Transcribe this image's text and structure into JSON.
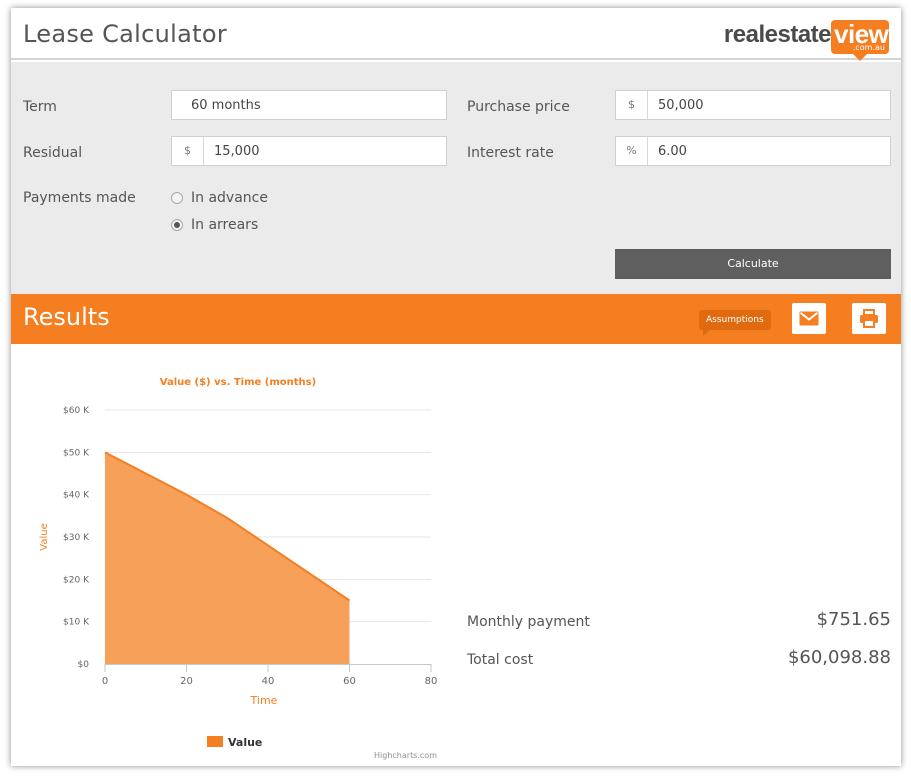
{
  "header": {
    "title": "Lease Calculator",
    "logo": {
      "brand": "realestate",
      "view": "view",
      "domain": ".com.au"
    }
  },
  "form": {
    "term": {
      "label": "Term",
      "value": "60 months"
    },
    "purchase_price": {
      "label": "Purchase price",
      "prefix": "$",
      "value": "50,000"
    },
    "residual": {
      "label": "Residual",
      "prefix": "$",
      "value": "15,000"
    },
    "interest_rate": {
      "label": "Interest rate",
      "prefix": "%",
      "value": "6.00"
    },
    "payments_made": {
      "label": "Payments made",
      "options": [
        "In advance",
        "In arrears"
      ],
      "selected": "In arrears"
    },
    "calculate_label": "Calculate"
  },
  "results": {
    "title": "Results",
    "assumptions_label": "Assumptions",
    "icons": [
      "envelope-icon",
      "print-icon"
    ],
    "monthly_payment": {
      "label": "Monthly payment",
      "value": "$751.65"
    },
    "total_cost": {
      "label": "Total cost",
      "value": "$60,098.88"
    }
  },
  "colors": {
    "accent": "#f47e20",
    "area_fill": "#f7a05a",
    "button_dark": "#5f5f5f",
    "form_bg": "#ebebeb"
  },
  "chart_data": {
    "type": "area",
    "title": "Value ($) vs. Time (months)",
    "xlabel": "Time",
    "ylabel": "Value",
    "xlim": [
      0,
      80
    ],
    "ylim": [
      0,
      60000
    ],
    "x_ticks": [
      "0",
      "20",
      "40",
      "60",
      "80"
    ],
    "y_ticks": [
      "$0",
      "$10 K",
      "$20 K",
      "$30 K",
      "$40 K",
      "$50 K",
      "$60 K"
    ],
    "grid": true,
    "legend": "bottom-center",
    "credits": "Highcharts.com",
    "series": [
      {
        "name": "Value",
        "x": [
          0,
          10,
          20,
          30,
          40,
          50,
          60
        ],
        "y": [
          50000,
          45000,
          40000,
          34500,
          28000,
          21500,
          15000
        ]
      }
    ]
  }
}
